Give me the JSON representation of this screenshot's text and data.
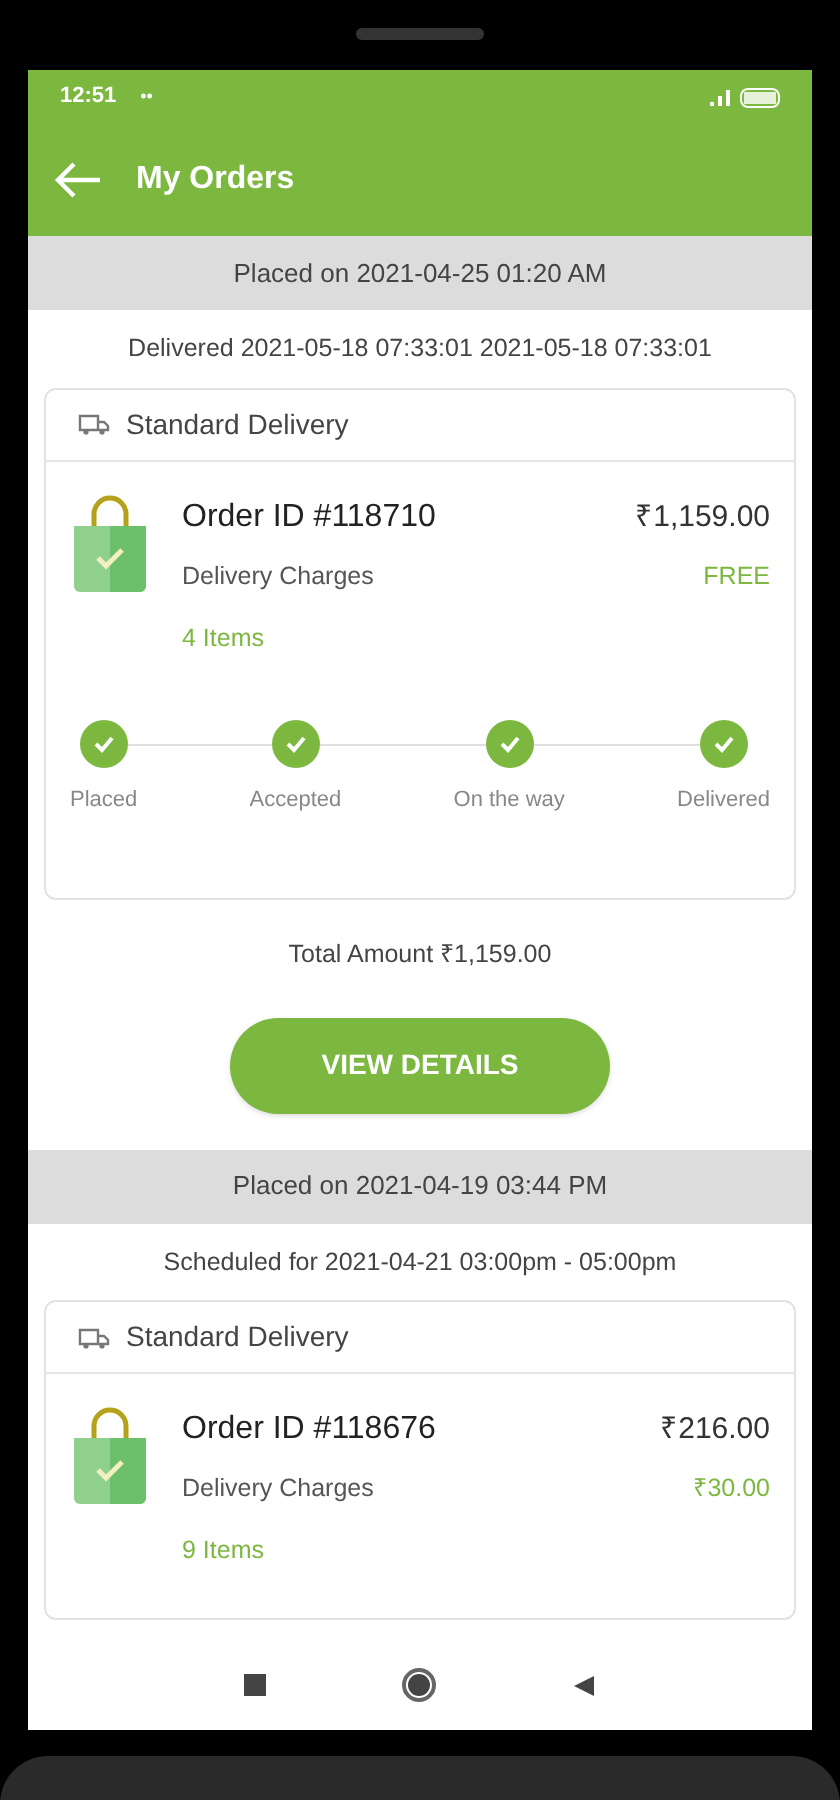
{
  "status_bar": {
    "time": "12:51",
    "dots": "••"
  },
  "app_bar": {
    "title": "My Orders"
  },
  "orders": [
    {
      "placed": "Placed on 2021-04-25 01:20 AM",
      "status_line": "Delivered  2021-05-18 07:33:01  2021-05-18 07:33:01",
      "delivery_type": "Standard Delivery",
      "order_id": "Order ID #118710",
      "amount": "₹1,159.00",
      "charges_label": "Delivery Charges",
      "charges": "FREE",
      "items": "4 Items",
      "steps": [
        {
          "label": "Placed",
          "done": true
        },
        {
          "label": "Accepted",
          "done": true
        },
        {
          "label": "On the way",
          "done": true
        },
        {
          "label": "Delivered",
          "done": true
        }
      ],
      "total": "Total Amount  ₹1,159.00",
      "button": "VIEW DETAILS"
    },
    {
      "placed": "Placed on 2021-04-19 03:44 PM",
      "status_line": "Scheduled for 2021-04-21  03:00pm - 05:00pm",
      "delivery_type": "Standard Delivery",
      "order_id": "Order ID #118676",
      "amount": "₹216.00",
      "charges_label": "Delivery Charges",
      "charges": "₹30.00",
      "items": "9 Items"
    }
  ]
}
